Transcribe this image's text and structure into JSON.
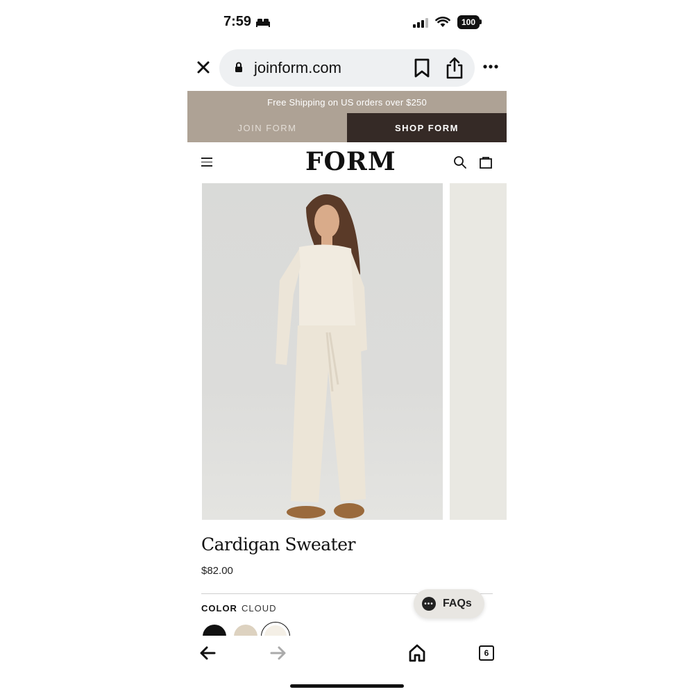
{
  "status_bar": {
    "time": "7:59",
    "battery": "100"
  },
  "browser": {
    "url": "joinform.com",
    "icons": [
      "close-icon",
      "lock-icon",
      "bookmark-icon",
      "share-icon",
      "more-icon"
    ]
  },
  "promo_banner": {
    "text": "Free Shipping on US orders over $250"
  },
  "site_tabs": {
    "join_label": "JOIN FORM",
    "shop_label": "SHOP FORM"
  },
  "header": {
    "logo": "FORM",
    "icons": [
      "menu-icon",
      "search-icon",
      "bag-icon"
    ]
  },
  "product": {
    "title": "Cardigan Sweater",
    "price": "$82.00",
    "color_label": "COLOR",
    "color_value": "CLOUD",
    "swatches": [
      {
        "name": "black",
        "color": "#111111"
      },
      {
        "name": "sand",
        "color": "#ddd2c0"
      },
      {
        "name": "cloud",
        "color": "#f4efe6",
        "selected": true
      }
    ]
  },
  "faq_button": {
    "label": "FAQs"
  },
  "toolbar": {
    "tab_count": "6",
    "icons": [
      "back-arrow-icon",
      "forward-arrow-icon",
      "home-icon",
      "tabs-icon"
    ]
  },
  "colors": {
    "banner_bg": "#aea295",
    "shop_tab_bg": "#352a26"
  }
}
